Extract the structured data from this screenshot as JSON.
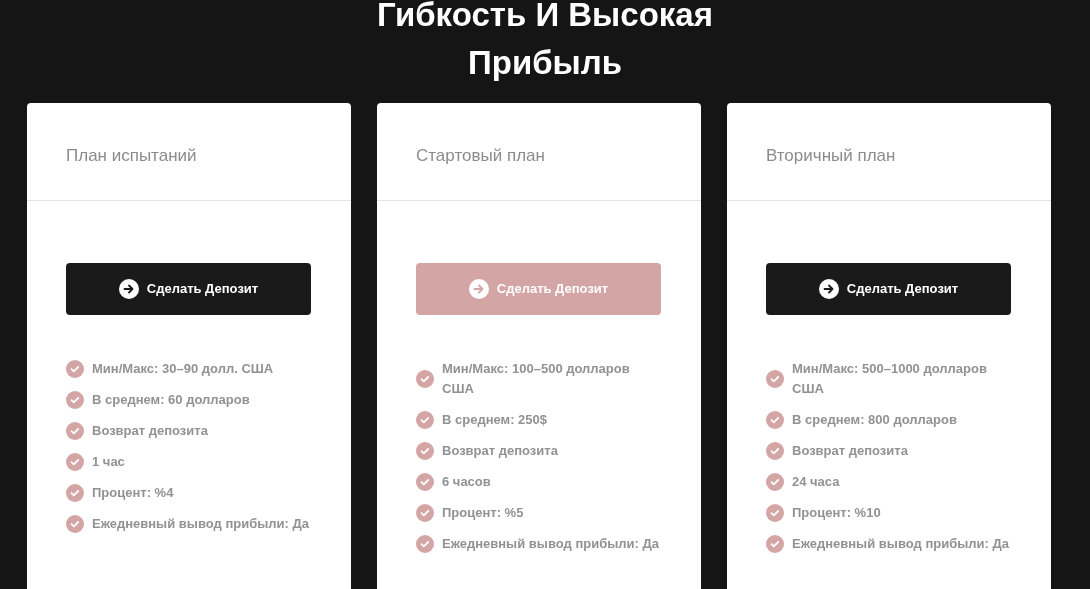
{
  "heading": [
    "Гибкость И Высокая",
    "Прибыль"
  ],
  "plans": [
    {
      "name": "План испытаний",
      "button": "Сделать Депозит",
      "featured": false,
      "features": [
        "Мин/Макс: 30–90 долл. США",
        "В среднем: 60 долларов",
        "Возврат депозита",
        "1 час",
        "Процент: %4",
        "Ежедневный вывод прибыли: Да"
      ]
    },
    {
      "name": "Стартовый план",
      "button": "Сделать Депозит",
      "featured": true,
      "features": [
        "Мин/Макс: 100–500 долларов США",
        "В среднем: 250$",
        "Возврат депозита",
        "6 часов",
        "Процент: %5",
        "Ежедневный вывод прибыли: Да"
      ]
    },
    {
      "name": "Вторичный план",
      "button": "Сделать Депозит",
      "featured": false,
      "features": [
        "Мин/Макс: 500–1000 долларов США",
        "В среднем: 800 долларов",
        "Возврат депозита",
        "24 часа",
        "Процент: %10",
        "Ежедневный вывод прибыли: Да"
      ]
    }
  ]
}
